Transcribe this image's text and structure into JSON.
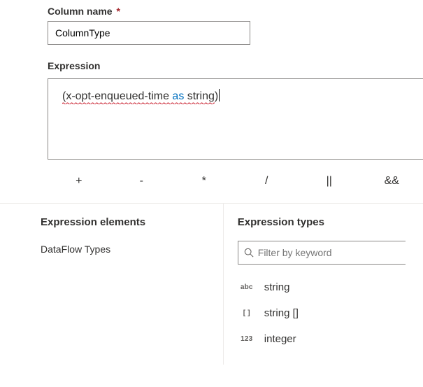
{
  "columnName": {
    "label": "Column name",
    "required": "*",
    "value": "ColumnType"
  },
  "expression": {
    "label": "Expression",
    "parts": {
      "open": "(",
      "identifier": "x-opt-enqueued-time",
      "space1": " ",
      "as": "as",
      "space2": " ",
      "type": "string",
      "close": ")"
    }
  },
  "operators": [
    "+",
    "-",
    "*",
    "/",
    "||",
    "&&"
  ],
  "elements": {
    "title": "Expression elements",
    "items": [
      "DataFlow Types"
    ]
  },
  "types": {
    "title": "Expression types",
    "filterPlaceholder": "Filter by keyword",
    "list": [
      {
        "prefix": "abc",
        "label": "string"
      },
      {
        "prefix": "[ ]",
        "label": "string []"
      },
      {
        "prefix": "123",
        "label": "integer"
      }
    ]
  }
}
